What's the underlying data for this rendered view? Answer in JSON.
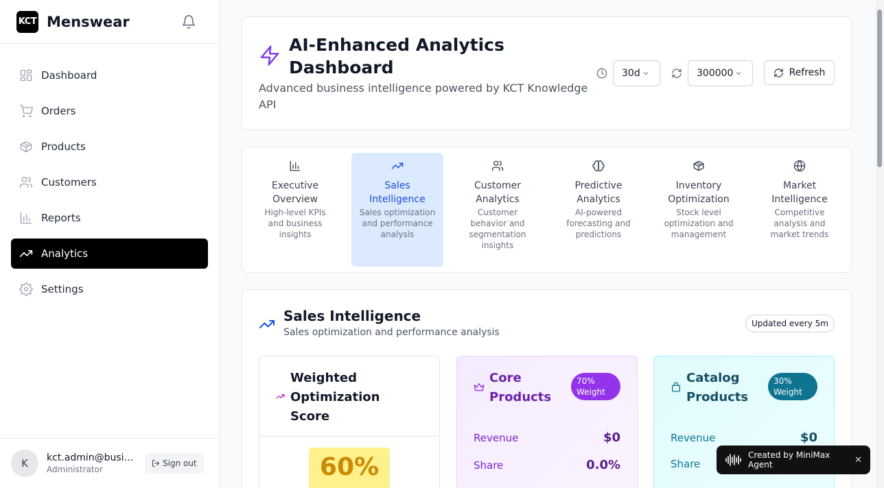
{
  "app": {
    "logo_text": "KCT",
    "name": "Menswear"
  },
  "sidebar": {
    "items": [
      {
        "label": "Dashboard",
        "icon": "grid-icon"
      },
      {
        "label": "Orders",
        "icon": "cart-icon"
      },
      {
        "label": "Products",
        "icon": "package-icon"
      },
      {
        "label": "Customers",
        "icon": "users-icon"
      },
      {
        "label": "Reports",
        "icon": "bar-chart-icon"
      },
      {
        "label": "Analytics",
        "icon": "trending-up-icon",
        "active": true
      },
      {
        "label": "Settings",
        "icon": "gear-icon"
      }
    ]
  },
  "user": {
    "initial": "K",
    "email": "kct.admin@business.com",
    "role": "Administrator",
    "sign_out_label": "Sign out"
  },
  "header": {
    "title": "AI-Enhanced Analytics Dashboard",
    "subtitle": "Advanced business intelligence powered by KCT Knowledge API",
    "period_value": "30d",
    "interval_value": "300000",
    "refresh_label": "Refresh"
  },
  "tabs": [
    {
      "label": "Executive Overview",
      "desc": "High-level KPIs and business insights",
      "icon": "bar-chart-icon"
    },
    {
      "label": "Sales Intelligence",
      "desc": "Sales optimization and performance analysis",
      "icon": "trending-up-icon",
      "active": true
    },
    {
      "label": "Customer Analytics",
      "desc": "Customer behavior and segmentation insights",
      "icon": "users-icon"
    },
    {
      "label": "Predictive Analytics",
      "desc": "AI-powered forecasting and predictions",
      "icon": "brain-icon"
    },
    {
      "label": "Inventory Optimization",
      "desc": "Stock level optimization and management",
      "icon": "package-icon"
    },
    {
      "label": "Market Intelligence",
      "desc": "Competitive analysis and market trends",
      "icon": "globe-icon"
    }
  ],
  "section": {
    "title": "Sales Intelligence",
    "subtitle": "Sales optimization and performance analysis",
    "updated_badge": "Updated every 5m"
  },
  "optimization": {
    "title": "Weighted Optimization Score",
    "score": "60%"
  },
  "core_products": {
    "title": "Core Products",
    "weight": "70% Weight",
    "revenue_label": "Revenue",
    "revenue_value": "$0",
    "share_label": "Share",
    "share_value": "0.0%"
  },
  "catalog_products": {
    "title": "Catalog Products",
    "weight": "30% Weight",
    "revenue_label": "Revenue",
    "revenue_value": "$0",
    "share_label": "Share"
  },
  "toast": {
    "text": "Created by MiniMax Agent",
    "close": "✕"
  },
  "colors": {
    "accent_purple": "#7c3aed",
    "active_tab_blue": "#1d4ed8",
    "score_yellow": "#fef08a"
  }
}
